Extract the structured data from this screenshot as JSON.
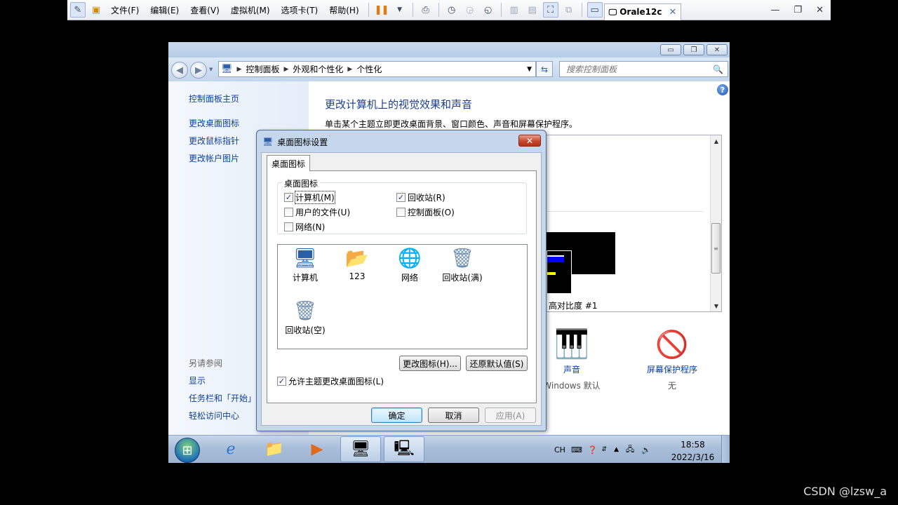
{
  "vmware": {
    "menus": [
      "文件(F)",
      "编辑(E)",
      "查看(V)",
      "虚拟机(M)",
      "选项卡(T)",
      "帮助(H)"
    ],
    "tab_title": "Orale12c"
  },
  "explorer": {
    "breadcrumb": [
      "控制面板",
      "外观和个性化",
      "个性化"
    ],
    "search_placeholder": "搜索控制面板",
    "left_links": [
      "控制面板主页",
      "更改桌面图标",
      "更改鼠标指针",
      "更改帐户图片"
    ],
    "see_also_heading": "另请参阅",
    "see_also_links": [
      "显示",
      "任务栏和「开始」",
      "轻松访问中心"
    ],
    "main_title": "更改计算机上的视觉效果和声音",
    "main_subtitle": "单击某个主题立即更改桌面背景、窗口颜色、声音和屏幕保护程序。",
    "theme_label": "高对比度 #1",
    "sound": {
      "label": "声音",
      "value": "Windows 默认"
    },
    "screensaver": {
      "label": "屏幕保护程序",
      "value": "无"
    }
  },
  "dialog": {
    "title": "桌面图标设置",
    "tab": "桌面图标",
    "group_title": "桌面图标",
    "checkboxes": [
      {
        "label": "计算机(M)",
        "checked": true
      },
      {
        "label": "回收站(R)",
        "checked": true
      },
      {
        "label": "用户的文件(U)",
        "checked": false
      },
      {
        "label": "控制面板(O)",
        "checked": false
      },
      {
        "label": "网络(N)",
        "checked": false
      }
    ],
    "icons": [
      "计算机",
      "123",
      "网络",
      "回收站(满)",
      "回收站(空)"
    ],
    "change_icon_button": "更改图标(H)...",
    "restore_default_button": "还原默认值(S)",
    "allow_themes_label": "允许主题更改桌面图标(L)",
    "allow_themes_checked": true,
    "ok_button": "确定",
    "cancel_button": "取消",
    "apply_button": "应用(A)"
  },
  "taskbar": {
    "tray_lang": "CH",
    "time": "18:58",
    "date": "2022/3/16"
  },
  "watermark": "CSDN @lzsw_a"
}
